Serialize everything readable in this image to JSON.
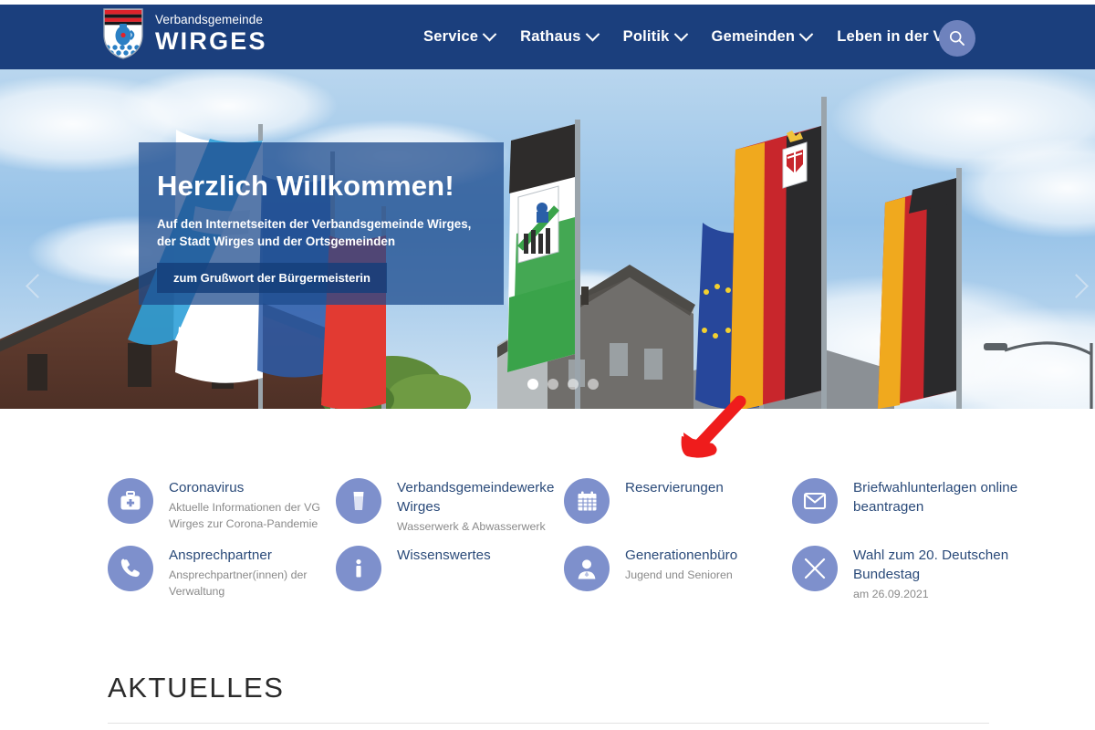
{
  "site": {
    "brand_line1": "Verbandsgemeinde",
    "brand_line2": "WIRGES"
  },
  "header": {
    "background_color": "#1b3f7d",
    "nav": [
      {
        "label": "Service",
        "has_dropdown": true
      },
      {
        "label": "Rathaus",
        "has_dropdown": true
      },
      {
        "label": "Politik",
        "has_dropdown": true
      },
      {
        "label": "Gemeinden",
        "has_dropdown": true
      },
      {
        "label": "Leben in der VG",
        "has_dropdown": true
      }
    ],
    "search_icon": "search-icon"
  },
  "hero": {
    "title": "Herzlich Willkommen!",
    "subtitle": "Auf den Internetseiten der Verbandsgemeinde Wirges, der Stadt Wirges und der Ortsgemeinden",
    "button_label": "zum Grußwort der Bürgermeisterin",
    "prev_icon": "chevron-left-icon",
    "next_icon": "chevron-right-icon",
    "slide_count": 4,
    "active_slide": 1,
    "overlay_color": "#1c4a8c"
  },
  "annotation": {
    "type": "arrow",
    "color": "#ef1c1c",
    "direction": "down-left",
    "points_to": "Reservierungen"
  },
  "quicklinks": {
    "icon_color": "#7e90cc",
    "columns": [
      {
        "items": [
          {
            "icon": "first-aid-kit-icon",
            "title": "Coronavirus",
            "desc": "Aktuelle Informationen der VG Wirges zur Corona-Pandemie"
          },
          {
            "icon": "phone-icon",
            "title": "Ansprechpartner",
            "desc": "Ansprechpartner(innen) der Verwaltung"
          }
        ]
      },
      {
        "items": [
          {
            "icon": "water-glass-icon",
            "title": "Verbandsgemeindewerke Wirges",
            "desc": "Wasserwerk & Abwasserwerk"
          },
          {
            "icon": "info-icon",
            "title": "Wissenswertes",
            "desc": ""
          }
        ]
      },
      {
        "items": [
          {
            "icon": "calendar-icon",
            "title": "Reservierungen",
            "desc": ""
          },
          {
            "icon": "person-icon",
            "title": "Generationenbüro",
            "desc": "Jugend und Senioren"
          }
        ]
      },
      {
        "items": [
          {
            "icon": "envelope-icon",
            "title": "Briefwahlunterlagen online beantragen",
            "desc": ""
          },
          {
            "icon": "cross-x-icon",
            "title": "Wahl zum 20. Deutschen Bundestag",
            "desc": "am 26.09.2021"
          }
        ]
      }
    ]
  },
  "news": {
    "heading": "AKTUELLES"
  }
}
